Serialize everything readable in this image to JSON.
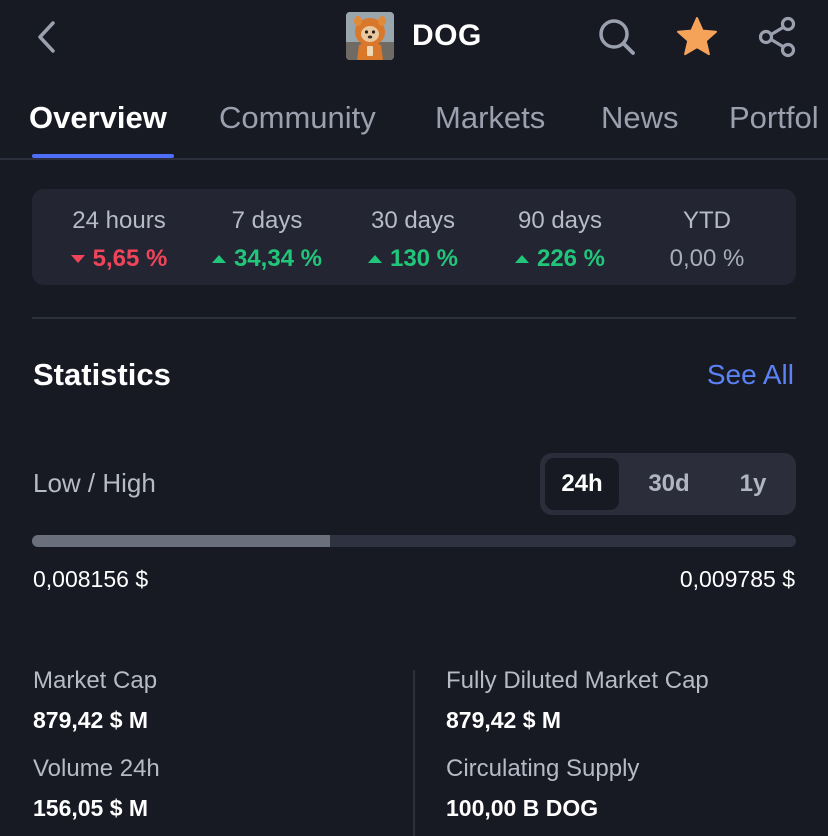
{
  "header": {
    "title": "DOG",
    "icons": {
      "back": "chevron-left-icon",
      "search": "search-icon",
      "favorite": "star-icon",
      "share": "share-icon"
    }
  },
  "tabs": [
    {
      "label": "Overview",
      "active": true
    },
    {
      "label": "Community",
      "active": false
    },
    {
      "label": "Markets",
      "active": false
    },
    {
      "label": "News",
      "active": false
    },
    {
      "label": "Portfol",
      "active": false
    }
  ],
  "performance": [
    {
      "label": "24 hours",
      "value": "5,65 %",
      "trend": "down"
    },
    {
      "label": "7 days",
      "value": "34,34 %",
      "trend": "up"
    },
    {
      "label": "30 days",
      "value": "130 %",
      "trend": "up"
    },
    {
      "label": "90 days",
      "value": "226 %",
      "trend": "up"
    },
    {
      "label": "YTD",
      "value": "0,00 %",
      "trend": "flat"
    }
  ],
  "statistics": {
    "title": "Statistics",
    "see_all": "See All",
    "low_high_label": "Low / High",
    "range_options": [
      {
        "label": "24h",
        "active": true
      },
      {
        "label": "30d",
        "active": false
      },
      {
        "label": "1y",
        "active": false
      }
    ],
    "low": "0,008156 $",
    "high": "0,009785 $",
    "position_fraction": 0.39,
    "items": [
      {
        "label": "Market Cap",
        "value": "879,42 $ M"
      },
      {
        "label": "Fully Diluted Market Cap",
        "value": "879,42 $ M"
      },
      {
        "label": "Volume 24h",
        "value": "156,05 $ M"
      },
      {
        "label": "Circulating Supply",
        "value": "100,00  B DOG"
      }
    ]
  },
  "colors": {
    "background": "#171923",
    "card": "#232632",
    "accent": "#4f6ef7",
    "link": "#5b82f5",
    "positive": "#22c67b",
    "negative": "#f0445a",
    "favorite": "#f6a35a"
  }
}
